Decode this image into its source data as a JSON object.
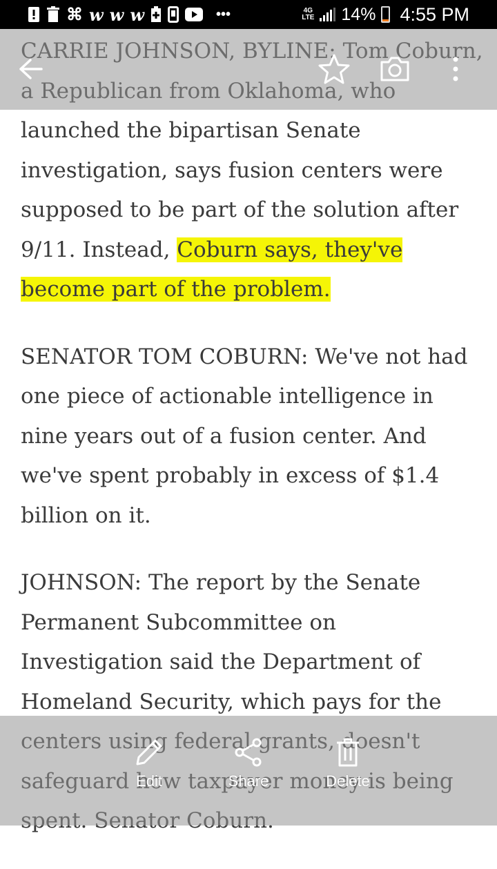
{
  "status_bar": {
    "time": "4:55 PM",
    "battery_percent": "14%",
    "battery_level": 0.14,
    "network_type": "4G",
    "network_sub": "LTE",
    "more_indicator": "•••",
    "notification_icons": [
      "alert-icon",
      "trash-icon",
      "command-icon",
      "w-icon",
      "w-icon",
      "w-icon",
      "battery-plus-icon",
      "phone-icon",
      "youtube-icon"
    ],
    "accent_battery_color": "#f07a1a"
  },
  "toolbar": {
    "icons": [
      "back-arrow-icon",
      "star-icon",
      "camera-icon",
      "more-vert-icon"
    ]
  },
  "article": {
    "paragraphs": [
      {
        "before": "CARRIE JOHNSON, BYLINE: Tom Coburn, a Republican from Oklahoma, who launched the bipartisan Senate investigation, says fusion centers were supposed to be part of the solution after 9/11. Instead, ",
        "highlight": "Coburn says, they've become part of the problem."
      },
      {
        "text": "SENATOR TOM COBURN: We've not had one piece of actionable intelligence in nine years out of a fusion center. And we've spent probably in excess of $1.4 billion on it."
      },
      {
        "text": "JOHNSON: The report by the Senate Permanent Subcommittee on Investigation said the Department of Homeland Security, which pays for the centers using federal grants, doesn't safeguard how taxpayer money is being spent. Senator Coburn."
      }
    ],
    "highlight_color": "#f5f506"
  },
  "bottom_bar": {
    "edit_label": "Edit",
    "share_label": "Share",
    "delete_label": "Delete"
  }
}
